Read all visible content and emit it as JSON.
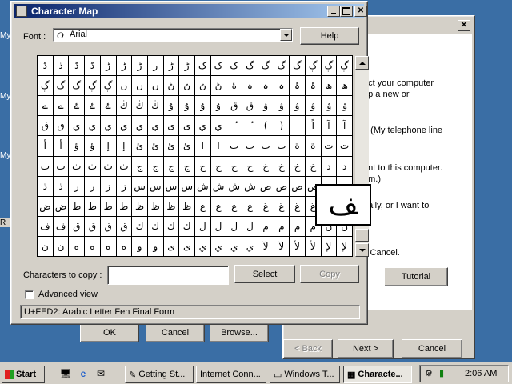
{
  "desktop": {
    "icon_labels": [
      "My",
      "My",
      "My",
      "R"
    ]
  },
  "wizard": {
    "close_glyph": "✕",
    "text_lines": [
      "ect your computer",
      "up a new or",
      "t. (My telephone line",
      "ant to this computer.",
      "em.)",
      "ually, or I want to",
      ".)",
      "k Cancel."
    ],
    "tutorial_label": "Tutorial",
    "back_label": "< Back",
    "next_label": "Next >",
    "cancel_label": "Cancel"
  },
  "charmap": {
    "title": "Character Map",
    "font_label": "Font :",
    "font_value": "Arial",
    "font_icon_glyph": "O",
    "help_label": "Help",
    "chars_to_copy_label": "Characters to copy :",
    "chars_to_copy_value": "",
    "select_label": "Select",
    "copy_label": "Copy",
    "advanced_view_label": "Advanced view",
    "advanced_view_checked": false,
    "status_text": "U+FED2: Arabic Letter Feh Final Form",
    "zoom_char": "ﻒ",
    "grid_rows": [
      [
        "ڈ",
        "ذ",
        "ڈ",
        "ڈ",
        "ڑ",
        "ڑ",
        "ڑ",
        "ر",
        "ڑ",
        "ڑ",
        "ک",
        "ک",
        "ک",
        "گ",
        "گ",
        "گ",
        "گ",
        "ڳ",
        "ڳ",
        "ڳ"
      ],
      [
        "ڳ",
        "گ",
        "گ",
        "ڳ",
        "ڳ",
        "ں",
        "ں",
        "ں",
        "ڻ",
        "ڻ",
        "ڻ",
        "ڻ",
        "ۀ",
        "ہ",
        "ہ",
        "ہ",
        "ۂ",
        "ۂ",
        "ھ",
        "ھ"
      ],
      [
        "ے",
        "ے",
        "ۓ",
        "ۓ",
        "ۓ",
        "ڭ",
        "ڭ",
        "ڭ",
        "ۇ",
        "ۇ",
        "ۇ",
        "ۇ",
        "ڨ",
        "ڨ",
        "ۋ",
        "ۋ",
        "ۋ",
        "ۋ",
        "ۉ",
        "ۉ"
      ],
      [
        "ڧ",
        "ڧ",
        "ي",
        "ي",
        "ي",
        "ي",
        "ي",
        "ي",
        "ى",
        "ى",
        "ي",
        "ي",
        "ٔ",
        "ٔ",
        "(",
        ")",
        "",
        "اً",
        "آ",
        "آ"
      ],
      [
        "أ",
        "أ",
        "ؤ",
        "ؤ",
        "إ",
        "إ",
        "ئ",
        "ئ",
        "ئ",
        "ئ",
        "ا",
        "ا",
        "ب",
        "ب",
        "ب",
        "ب",
        "ة",
        "ة",
        "ت",
        "ت"
      ],
      [
        "ت",
        "ت",
        "ث",
        "ث",
        "ث",
        "ث",
        "ج",
        "ج",
        "ج",
        "ج",
        "ح",
        "ح",
        "ح",
        "ح",
        "خ",
        "خ",
        "خ",
        "خ",
        "د",
        "د"
      ],
      [
        "ذ",
        "ذ",
        "ر",
        "ر",
        "ز",
        "ز",
        "س",
        "س",
        "س",
        "س",
        "ش",
        "ش",
        "ش",
        "ش",
        "ص",
        "ص",
        "ص",
        "ص",
        "ض",
        "ض"
      ],
      [
        "ض",
        "ض",
        "ط",
        "ط",
        "ط",
        "ط",
        "ظ",
        "ظ",
        "ظ",
        "ظ",
        "ع",
        "ع",
        "ع",
        "ع",
        "غ",
        "غ",
        "غ",
        "غ",
        "ف",
        "ف"
      ],
      [
        "ف",
        "ف",
        "ق",
        "ق",
        "ق",
        "ق",
        "ك",
        "ك",
        "ك",
        "ك",
        "ل",
        "ل",
        "ل",
        "ل",
        "م",
        "م",
        "م",
        "م",
        "ن",
        "ن"
      ],
      [
        "ن",
        "ن",
        "ه",
        "ه",
        "ه",
        "ه",
        "و",
        "و",
        "ى",
        "ى",
        "ي",
        "ي",
        "ي",
        "ي",
        "لآ",
        "لآ",
        "لأ",
        "لأ",
        "لإ",
        "لإ"
      ]
    ]
  },
  "bottom_buttons": {
    "ok": "OK",
    "cancel": "Cancel",
    "browse": "Browse..."
  },
  "taskbar": {
    "start_label": "Start",
    "tasks": [
      {
        "label": "Getting St...",
        "icon": "document-icon",
        "active": false
      },
      {
        "label": "Internet Conn...",
        "icon": "",
        "active": false
      },
      {
        "label": "Windows T...",
        "icon": "window-icon",
        "active": false
      },
      {
        "label": "Characte...",
        "icon": "charmap-icon",
        "active": true
      }
    ],
    "clock": "2:06 AM"
  }
}
